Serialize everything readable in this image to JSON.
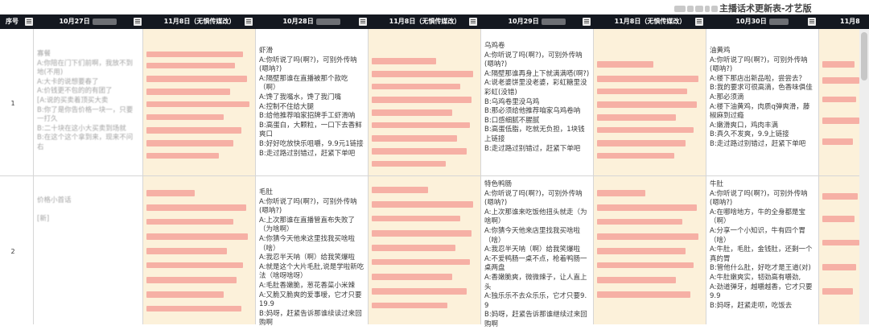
{
  "title": "主播话术更新表-才艺版",
  "header": {
    "cols": [
      {
        "label": "序号"
      },
      {
        "label": "10月27日"
      },
      {
        "label": "11月8日（无惧传媒改）"
      },
      {
        "label": "10月28日"
      },
      {
        "label": "11月8日（无惧传媒改）"
      },
      {
        "label": "10月29日"
      },
      {
        "label": "11月8日（无惧传媒改）"
      },
      {
        "label": "10月30日"
      },
      {
        "label": "11月8"
      }
    ]
  },
  "rows": [
    {
      "num": "1",
      "c1": "寡餐\nA:你陪在门下们前啊，我放不到地(不用)\nA:大卡的说想要春了\nA:价钱更不包的的有团了\n[A:说的买卖着顶买大卖\nB:你了是你告价格一块一，只要一打久\nB:二十块在这小大买卖到场就\nB:在这个这个拿到来，现来不问右",
      "c3": "虾滑\nA:你听说了吗(啊?)，可别外传呐(嗯呐?)\nA:隔壁那谁在直播被那个款吃（啊）\nA:馋了我嘴水，馋了我门嘴\nA:控制不住给大腿\nB:给他推荐咱家招牌手工虾滑呐\nB:高蛋白，大颗粒，一口下去香鲜爽口\nB:好好吃放快乐咀嚼，9.9元1链接\nB:走过路过别错过，赶紧下单吧",
      "c5": "乌鸡卷\nA:你听说了吗(啊?)，可别外传呐(嗯呐?)\nA:隔壁那谁再身上下就满满嗒(啊?)\nA:说老婆饼里没老婆，彩虹糖里没彩虹(没错)\nB:乌鸡卷里没乌鸡\nB:那必须给他推荐咱家乌鸡卷呐\nB:口感细腻不腥腻\nB:高蛋低脂，吃就无负担，1块钱上链接\nB:走过路过别错过，赶紧下单吧",
      "c7": "油黄鸡\nA:你听说了吗(啊?)，可别外传呐(嗯呐?)\nA:楼下那店出新品啦，尝尝去？\nB:我的要求可很高滴，色香味俱佳\nA:那必须滴\nA:楼下油黄鸡，肉质q弹爽滑，藤椒麻到过瘾\nA:嫩滑爽口，鸡肉丰满\nB:真久不发爽，9.9上链接\nB:走过路过别错过，赶紧下单吧"
    },
    {
      "num": "2",
      "c1": "价格小首话\n\n[新]\n\n\n\n\n\n",
      "c3": "毛肚\nA:你听说了吗(啊?)，可别外传呐(嗯呐?)\nA:上次那谁在直播管直布失败了（为啥啊）\nA:你猜今天他来这里找我买啥啦（啥）\nA:我忍半天呐（啊）给我笑爆啦\nA:就是这个大片毛肚,说是学啦新吃法（啥呀啥呀）\nA:毛肚香嫩脆，葱花香菜小米辣\nA:又脆又脆爽的爱事嗳，它才只要19.9\nB:妈呀，赶紧告诉那谁续读过来回购啊",
      "c5": "特色鸭肠\nA:你听说了吗(啊?)，可别外传呐(嗯呐?)\nA:上次那谁来吃饭他扭头就走（为啥啊）\nA:你猜今天他来店里找我买啥啦（啥）\nA:我忍半天呐（啊）给我笑爆啦\nA:不爱鸭肠一桌不点，枪着鸭肠一桌两盘\nA:香嫩脆爽，微微辣子，让人直上头\nA:独乐乐不去众乐乐，它才只要9.9\nB:妈呀，赶紧告诉那谁继续过来回购啊",
      "c7": "牛肚\nA:你听说了吗(啊?)，可别外传呐(嗯呐?)\nA:在哪啥地方，牛的全身都是宝（啊）\nA:分享一个小知识，牛有四个胃（啥）\nA:牛肚，毛肚，金钱肚，还剩一个真的胃\nB:管他什么肚，好吃才是王道(对)\nA:牛肚嫩爽实，韧劲高有嚼劲,\nA:劲道弹牙，越嚼越香，它才只要9.9\nB:妈呀，赶紧走呗，吃饭去"
    }
  ]
}
